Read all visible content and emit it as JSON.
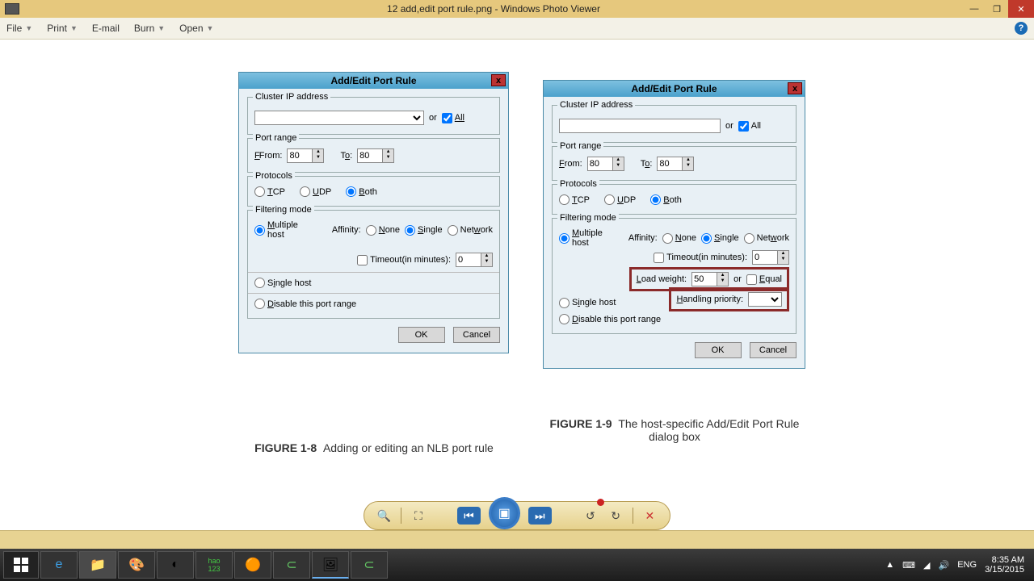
{
  "window": {
    "title": "12 add,edit port rule.png - Windows Photo Viewer"
  },
  "menu": {
    "file": "File",
    "print": "Print",
    "email": "E-mail",
    "burn": "Burn",
    "open": "Open"
  },
  "dlg1": {
    "title": "Add/Edit Port Rule",
    "cluster_label": "Cluster IP address",
    "or": "or",
    "all": "All",
    "portrange": "Port range",
    "from": "From:",
    "to": "To:",
    "from_val": "80",
    "to_val": "80",
    "protocols": "Protocols",
    "tcp": "TCP",
    "udp": "UDP",
    "both": "Both",
    "filtering": "Filtering mode",
    "multiple": "Multiple host",
    "affinity": "Affinity:",
    "none": "None",
    "single": "Single",
    "network": "Network",
    "timeout": "Timeout(in minutes):",
    "timeout_val": "0",
    "singlehost": "Single host",
    "disable": "Disable this port range",
    "ok": "OK",
    "cancel": "Cancel"
  },
  "dlg2": {
    "title": "Add/Edit Port Rule",
    "cluster_label": "Cluster IP address",
    "or": "or",
    "all": "All",
    "portrange": "Port range",
    "from": "From:",
    "to": "To:",
    "from_val": "80",
    "to_val": "80",
    "protocols": "Protocols",
    "tcp": "TCP",
    "udp": "UDP",
    "both": "Both",
    "filtering": "Filtering mode",
    "multiple": "Multiple host",
    "affinity": "Affinity:",
    "none": "None",
    "single": "Single",
    "network": "Network",
    "timeout": "Timeout(in minutes):",
    "timeout_val": "0",
    "load": "Load weight:",
    "load_val": "50",
    "or2": "or",
    "equal": "Equal",
    "handling": "Handling priority:",
    "singlehost": "Single host",
    "disable": "Disable this port range",
    "ok": "OK",
    "cancel": "Cancel"
  },
  "figs": {
    "a": "FIGURE 1-8",
    "a_txt": "Adding or editing an NLB port rule",
    "b": "FIGURE 1-9",
    "b_txt": "The host-specific Add/Edit Port Rule dialog box"
  },
  "tray": {
    "lang": "ENG",
    "time": "8:35 AM",
    "date": "3/15/2015"
  }
}
